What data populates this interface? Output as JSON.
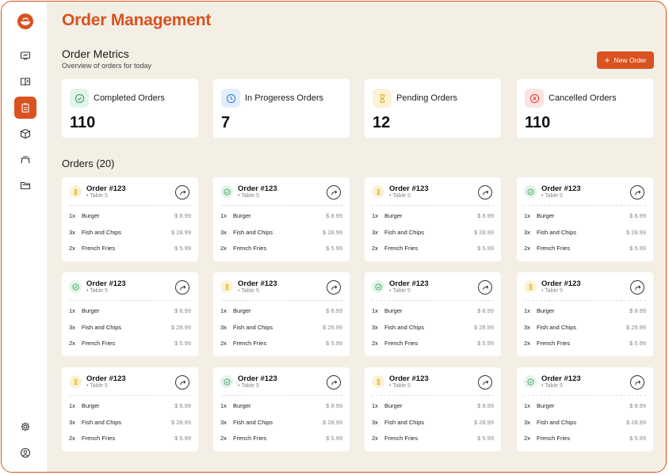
{
  "page": {
    "title": "Order Management"
  },
  "sidebar": {
    "items": [
      {
        "icon": "presentation-icon"
      },
      {
        "icon": "menu-book-icon"
      },
      {
        "icon": "clipboard-icon",
        "active": true
      },
      {
        "icon": "box-icon"
      },
      {
        "icon": "table-icon"
      },
      {
        "icon": "folder-icon"
      }
    ],
    "bottom": [
      {
        "icon": "gear-icon"
      },
      {
        "icon": "user-icon"
      }
    ]
  },
  "metrics_section": {
    "title": "Order Metrics",
    "subtitle": "Overview of orders for today",
    "new_order_label": "New Order",
    "cards": [
      {
        "label": "Completed Orders",
        "value": "110",
        "status": "completed"
      },
      {
        "label": "In Progeress Orders",
        "value": "7",
        "status": "in-progress"
      },
      {
        "label": "Pending Orders",
        "value": "12",
        "status": "pending"
      },
      {
        "label": "Cancelled Orders",
        "value": "110",
        "status": "cancelled"
      }
    ]
  },
  "orders": {
    "title": "Orders (20)",
    "list": [
      {
        "title": "Order #123",
        "table": "• Table 5",
        "status": "pending",
        "items": [
          {
            "qty": "1x",
            "name": "Burger",
            "price": "$ 8.99"
          },
          {
            "qty": "3x",
            "name": "Fish and Chips",
            "price": "$ 28.99"
          },
          {
            "qty": "2x",
            "name": "French Fries",
            "price": "$ 5.99"
          }
        ]
      },
      {
        "title": "Order #123",
        "table": "• Table 5",
        "status": "completed",
        "items": [
          {
            "qty": "1x",
            "name": "Burger",
            "price": "$ 8.99"
          },
          {
            "qty": "3x",
            "name": "Fish and Chips",
            "price": "$ 28.99"
          },
          {
            "qty": "2x",
            "name": "French Fries",
            "price": "$ 5.99"
          }
        ]
      },
      {
        "title": "Order #123",
        "table": "• Table 5",
        "status": "pending",
        "items": [
          {
            "qty": "1x",
            "name": "Burger",
            "price": "$ 8.99"
          },
          {
            "qty": "3x",
            "name": "Fish and Chips",
            "price": "$ 28.99"
          },
          {
            "qty": "2x",
            "name": "French Fries",
            "price": "$ 5.99"
          }
        ]
      },
      {
        "title": "Order #123",
        "table": "• Table 5",
        "status": "completed",
        "items": [
          {
            "qty": "1x",
            "name": "Burger",
            "price": "$ 8.99"
          },
          {
            "qty": "3x",
            "name": "Fish and Chips",
            "price": "$ 28.99"
          },
          {
            "qty": "2x",
            "name": "French Fries",
            "price": "$ 5.99"
          }
        ]
      },
      {
        "title": "Order #123",
        "table": "• Table 5",
        "status": "completed",
        "items": [
          {
            "qty": "1x",
            "name": "Burger",
            "price": "$ 8.99"
          },
          {
            "qty": "3x",
            "name": "Fish and Chips",
            "price": "$ 28.99"
          },
          {
            "qty": "2x",
            "name": "French Fries",
            "price": "$ 5.99"
          }
        ]
      },
      {
        "title": "Order #123",
        "table": "• Table 5",
        "status": "pending",
        "items": [
          {
            "qty": "1x",
            "name": "Burger",
            "price": "$ 8.99"
          },
          {
            "qty": "3x",
            "name": "Fish and Chips",
            "price": "$ 28.99"
          },
          {
            "qty": "2x",
            "name": "French Fries",
            "price": "$ 5.99"
          }
        ]
      },
      {
        "title": "Order #123",
        "table": "• Table 5",
        "status": "completed",
        "items": [
          {
            "qty": "1x",
            "name": "Burger",
            "price": "$ 8.99"
          },
          {
            "qty": "3x",
            "name": "Fish and Chips",
            "price": "$ 28.99"
          },
          {
            "qty": "2x",
            "name": "French Fries",
            "price": "$ 5.99"
          }
        ]
      },
      {
        "title": "Order #123",
        "table": "• Table 5",
        "status": "pending",
        "items": [
          {
            "qty": "1x",
            "name": "Burger",
            "price": "$ 8.99"
          },
          {
            "qty": "3x",
            "name": "Fish and Chips",
            "price": "$ 28.99"
          },
          {
            "qty": "2x",
            "name": "French Fries",
            "price": "$ 5.99"
          }
        ]
      },
      {
        "title": "Order #123",
        "table": "• Table 5",
        "status": "pending",
        "items": [
          {
            "qty": "1x",
            "name": "Burger",
            "price": "$ 8.99"
          },
          {
            "qty": "3x",
            "name": "Fish and Chips",
            "price": "$ 28.99"
          },
          {
            "qty": "2x",
            "name": "French Fries",
            "price": "$ 5.99"
          }
        ]
      },
      {
        "title": "Order #123",
        "table": "• Table 5",
        "status": "completed",
        "items": [
          {
            "qty": "1x",
            "name": "Burger",
            "price": "$ 8.99"
          },
          {
            "qty": "3x",
            "name": "Fish and Chips",
            "price": "$ 28.99"
          },
          {
            "qty": "2x",
            "name": "French Fries",
            "price": "$ 5.99"
          }
        ]
      },
      {
        "title": "Order #123",
        "table": "• Table 5",
        "status": "pending",
        "items": [
          {
            "qty": "1x",
            "name": "Burger",
            "price": "$ 8.99"
          },
          {
            "qty": "3x",
            "name": "Fish and Chips",
            "price": "$ 28.99"
          },
          {
            "qty": "2x",
            "name": "French Fries",
            "price": "$ 5.99"
          }
        ]
      },
      {
        "title": "Order #123",
        "table": "• Table 5",
        "status": "completed",
        "items": [
          {
            "qty": "1x",
            "name": "Burger",
            "price": "$ 8.99"
          },
          {
            "qty": "3x",
            "name": "Fish and Chips",
            "price": "$ 28.99"
          },
          {
            "qty": "2x",
            "name": "French Fries",
            "price": "$ 5.99"
          }
        ]
      }
    ]
  },
  "colors": {
    "accent": "#d9521f",
    "background": "#f4efe5",
    "completed": "#3aa55d",
    "in_progress": "#3b82e6",
    "pending": "#e5b000",
    "cancelled": "#e0443a"
  }
}
